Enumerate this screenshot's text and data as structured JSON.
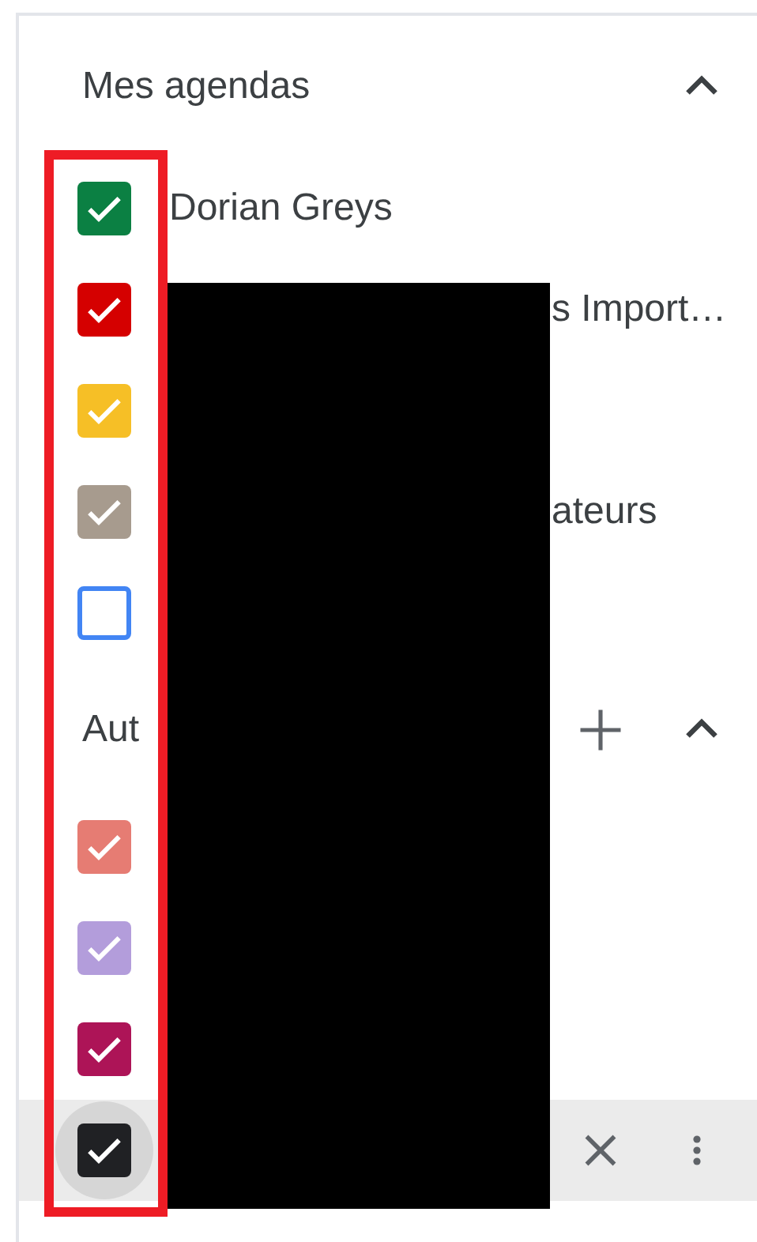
{
  "sections": [
    {
      "title": "Mes agendas",
      "expanded": true,
      "add_button": false,
      "calendars": [
        {
          "label": "Dorian Greys",
          "color": "#0b8043",
          "checked": true,
          "covered": false,
          "hovered": false
        },
        {
          "label": "s Import…",
          "color": "#d50000",
          "checked": true,
          "covered": true,
          "hovered": false
        },
        {
          "color": "#f6bf26",
          "checked": true,
          "hovered": false
        },
        {
          "label": "ateurs",
          "color": "#a79b8e",
          "checked": true,
          "covered": true,
          "hovered": false
        },
        {
          "color": "#4285f4",
          "checked": false,
          "hovered": false
        }
      ]
    },
    {
      "title": "Aut",
      "expanded": true,
      "add_button": true,
      "calendars": [
        {
          "color": "#e67c73",
          "checked": true,
          "hovered": false
        },
        {
          "color": "#b39ddb",
          "checked": true,
          "hovered": false
        },
        {
          "color": "#ad1457",
          "checked": true,
          "hovered": false
        },
        {
          "color": "#202124",
          "checked": true,
          "hovered": true
        }
      ]
    }
  ]
}
